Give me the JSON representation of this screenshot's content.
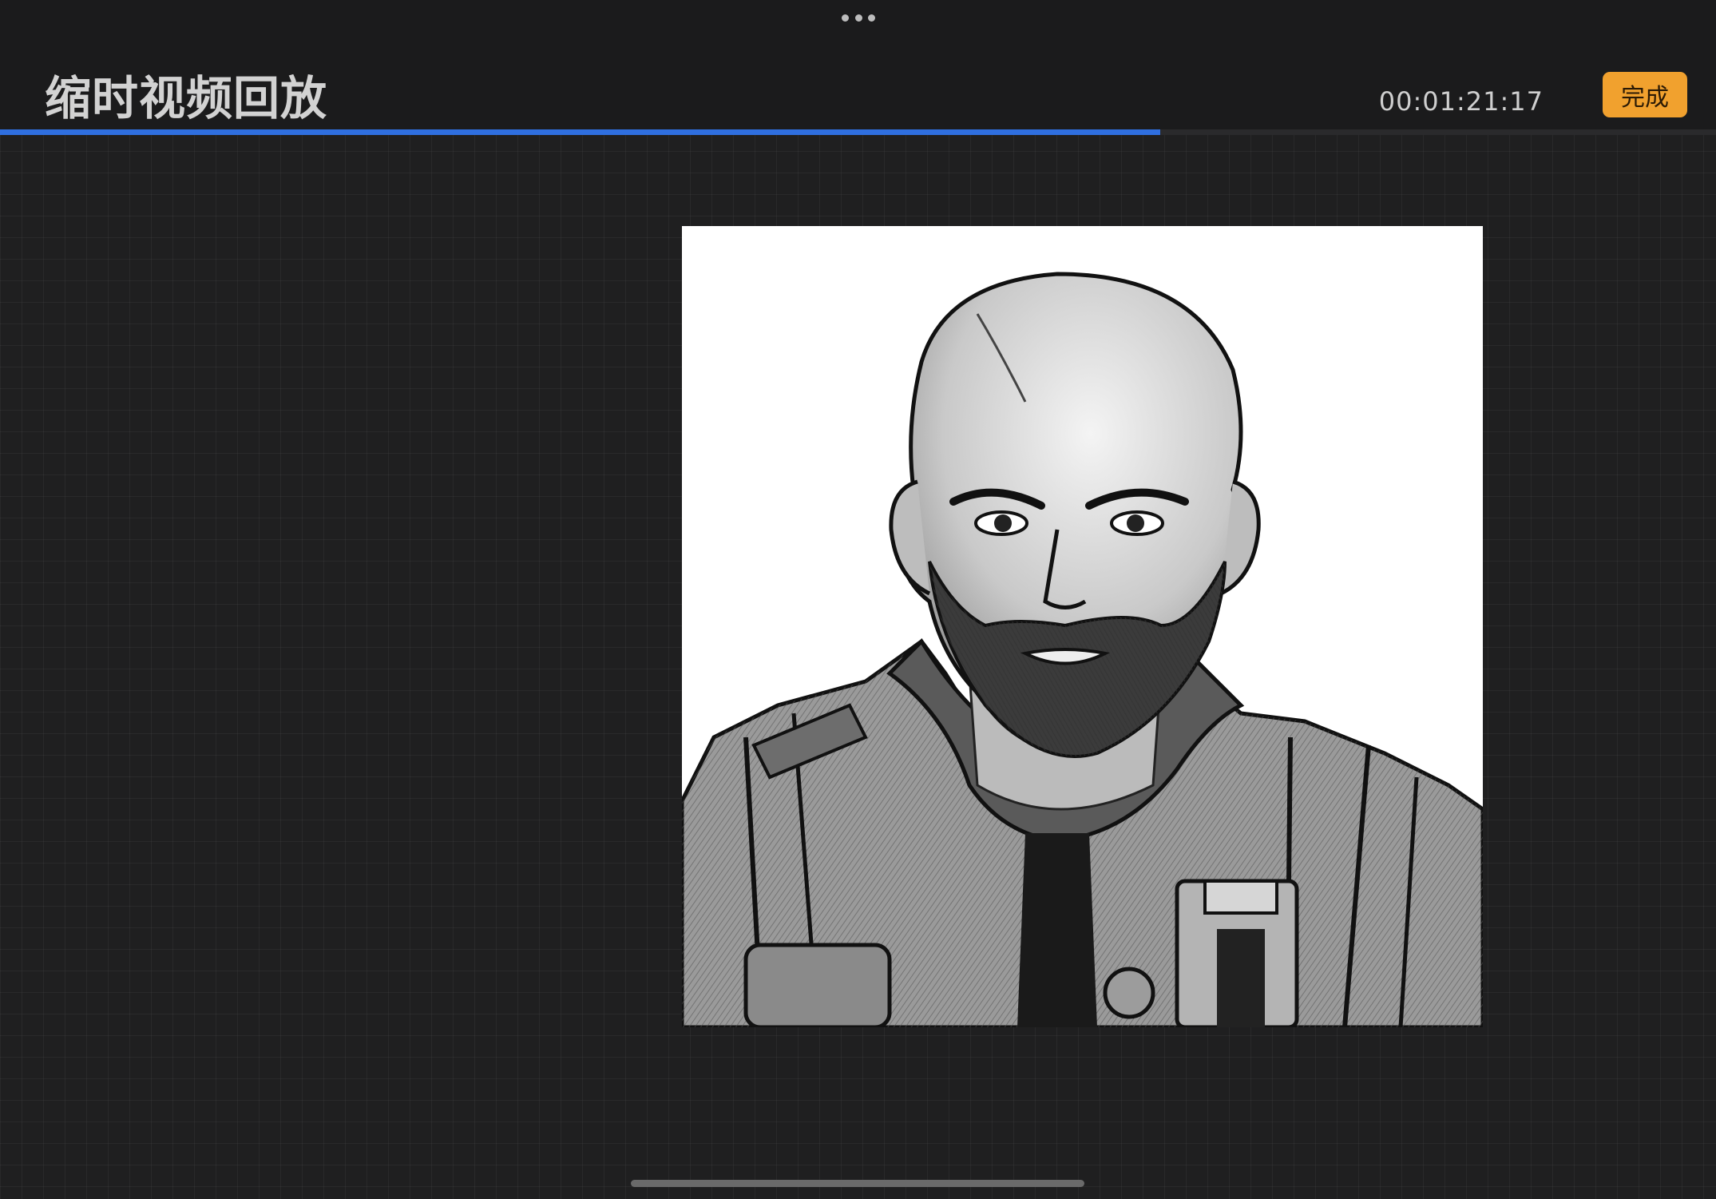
{
  "header": {
    "title": "缩时视频回放",
    "timecode": "00:01:21:17",
    "done_label": "完成",
    "menu_icon": "more-dots-icon"
  },
  "playback": {
    "progress": 0.676
  },
  "colors": {
    "accent_button": "#f1a12e",
    "progress_bar": "#2f6fe0",
    "background": "#1f1f20"
  }
}
